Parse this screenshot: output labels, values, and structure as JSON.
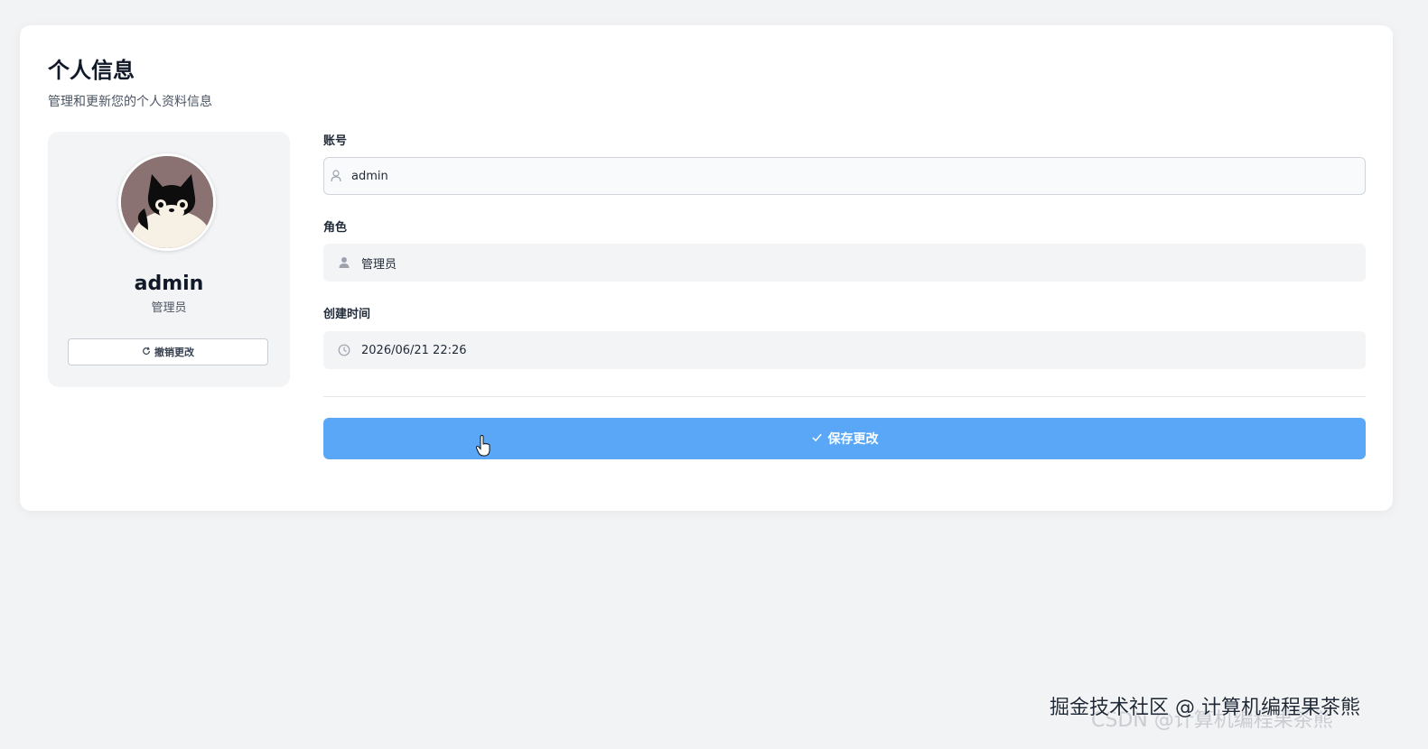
{
  "header": {
    "title": "个人信息",
    "subtitle": "管理和更新您的个人资料信息"
  },
  "profile": {
    "name": "admin",
    "role": "管理员",
    "revert_label": "撤销更改"
  },
  "form": {
    "account": {
      "label": "账号",
      "value": "admin",
      "icon": "user-outline-icon"
    },
    "role": {
      "label": "角色",
      "value": "管理员",
      "icon": "user-filled-icon"
    },
    "created": {
      "label": "创建时间",
      "value": "2026/06/21 22:26",
      "icon": "clock-icon"
    },
    "save_label": "保存更改"
  },
  "watermark": {
    "primary": "掘金技术社区 @ 计算机编程果茶熊",
    "ghost": "CSDN @计算机编程果茶熊"
  },
  "colors": {
    "background": "#f2f3f5",
    "card": "#ffffff",
    "primary_button": "#5aa7f8",
    "field_background": "#f3f4f6"
  }
}
